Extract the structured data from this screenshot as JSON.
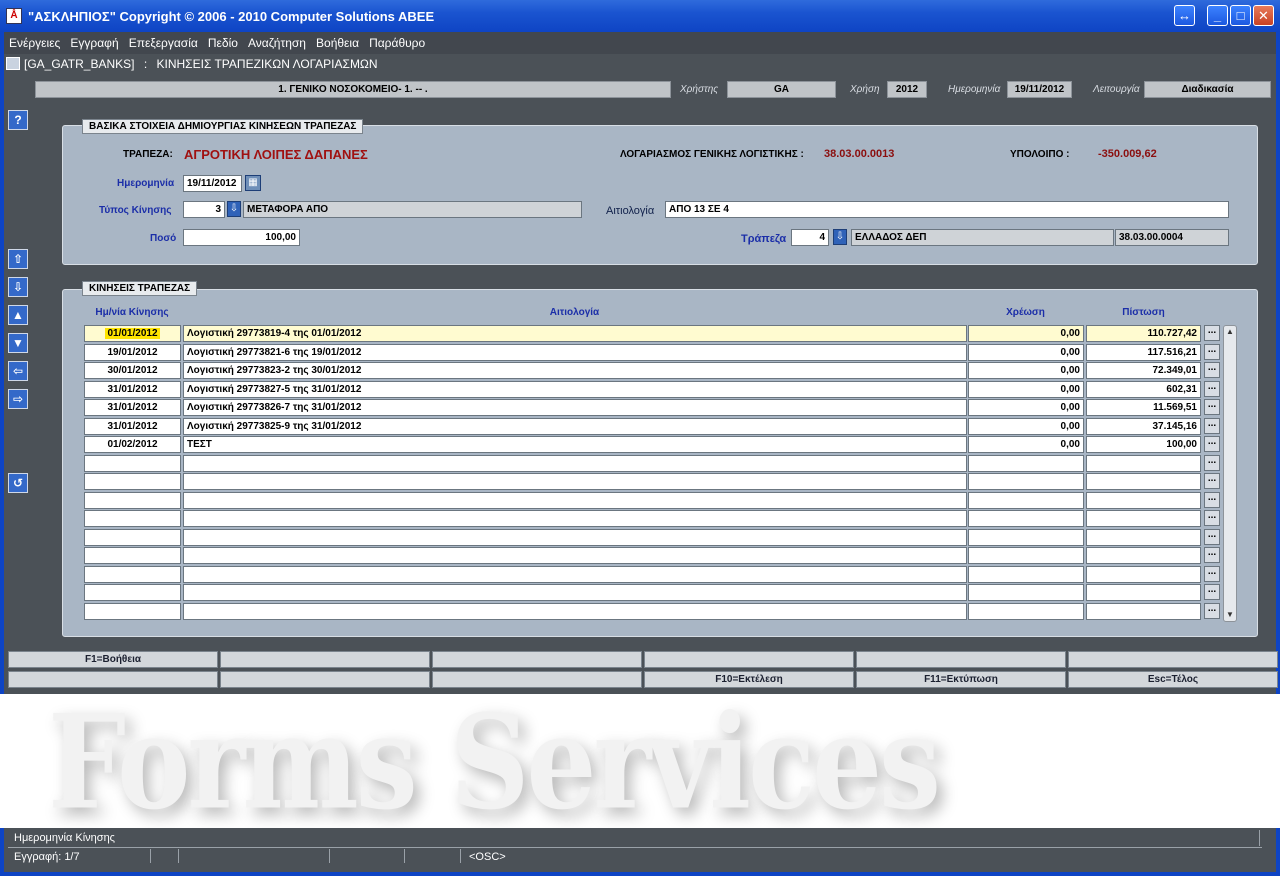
{
  "window": {
    "title": "\"ΑΣΚΛΗΠΙΟΣ\" Copyright © 2006 - 2010 Computer Solutions ABEE",
    "app_icon": "Å"
  },
  "menubar": [
    "Ενέργειες",
    "Εγγραφή",
    "Επεξεργασία",
    "Πεδίο",
    "Αναζήτηση",
    "Βοήθεια",
    "Παράθυρο"
  ],
  "form": {
    "code": "[GA_GATR_BANKS]",
    "separator": ":",
    "title": "ΚΙΝΗΣΕΙΣ ΤΡΑΠΕΖΙΚΩΝ ΛΟΓΑΡΙΑΣΜΩΝ"
  },
  "header": {
    "organization": "1. ΓΕΝΙΚΟ ΝΟΣΟΚΟΜΕΙΟ- 1. -- .",
    "user_label": "Χρήστης",
    "user_value": "GA",
    "year_label": "Χρήση",
    "year_value": "2012",
    "date_label": "Ημερομηνία",
    "date_value": "19/11/2012",
    "function_label": "Λειτουργία",
    "function_value": "Διαδικασία"
  },
  "basic_panel": {
    "title": "ΒΑΣΙΚΑ ΣΤΟΙΧΕΙΑ ΔΗΜΙΟΥΡΓΙΑΣ ΚΙΝΗΣΕΩΝ ΤΡΑΠΕΖΑΣ",
    "bank_label": "ΤΡΑΠΕΖΑ:",
    "bank_value": "ΑΓΡΟΤΙΚΗ ΛΟΙΠΕΣ ΔΑΠΑΝΕΣ",
    "gl_label": "ΛΟΓΑΡΙΑΣΜΟΣ ΓΕΝΙΚΗΣ ΛΟΓΙΣΤΙΚΗΣ :",
    "gl_value": "38.03.00.0013",
    "balance_label": "ΥΠΟΛΟΙΠΟ :",
    "balance_value": "-350.009,62",
    "date_label": "Ημερομηνία",
    "date_value": "19/11/2012",
    "type_label": "Τύπος Κίνησης",
    "type_code": "3",
    "type_desc": "ΜΕΤΑΦΟΡΑ ΑΠΟ",
    "reason_label": "Αιτιολογία",
    "reason_value": "ΑΠΟ 13 ΣΕ 4",
    "amount_label": "Ποσό",
    "amount_value": "100,00",
    "target_bank_label": "Τράπεζα",
    "target_bank_code": "4",
    "target_bank_desc": "ΕΛΛΑΔΟΣ ΔΕΠ",
    "target_bank_account": "38.03.00.0004"
  },
  "grid": {
    "title": "ΚΙΝΗΣΕΙΣ ΤΡΑΠΕΖΑΣ",
    "columns": {
      "date": "Ημ/νία Κίνησης",
      "reason": "Αιτιολογία",
      "debit": "Χρέωση",
      "credit": "Πίστωση"
    },
    "rows": [
      {
        "date": "01/01/2012",
        "reason": "Λογιστική 29773819-4 της 01/01/2012",
        "debit": "0,00",
        "credit": "110.727,42"
      },
      {
        "date": "19/01/2012",
        "reason": "Λογιστική 29773821-6 της 19/01/2012",
        "debit": "0,00",
        "credit": "117.516,21"
      },
      {
        "date": "30/01/2012",
        "reason": "Λογιστική 29773823-2 της 30/01/2012",
        "debit": "0,00",
        "credit": "72.349,01"
      },
      {
        "date": "31/01/2012",
        "reason": "Λογιστική 29773827-5 της 31/01/2012",
        "debit": "0,00",
        "credit": "602,31"
      },
      {
        "date": "31/01/2012",
        "reason": "Λογιστική 29773826-7 της 31/01/2012",
        "debit": "0,00",
        "credit": "11.569,51"
      },
      {
        "date": "31/01/2012",
        "reason": "Λογιστική 29773825-9 της 31/01/2012",
        "debit": "0,00",
        "credit": "37.145,16"
      },
      {
        "date": "01/02/2012",
        "reason": "ΤΕΣΤ",
        "debit": "0,00",
        "credit": "100,00"
      },
      {
        "date": "",
        "reason": "",
        "debit": "",
        "credit": ""
      },
      {
        "date": "",
        "reason": "",
        "debit": "",
        "credit": ""
      },
      {
        "date": "",
        "reason": "",
        "debit": "",
        "credit": ""
      },
      {
        "date": "",
        "reason": "",
        "debit": "",
        "credit": ""
      },
      {
        "date": "",
        "reason": "",
        "debit": "",
        "credit": ""
      },
      {
        "date": "",
        "reason": "",
        "debit": "",
        "credit": ""
      },
      {
        "date": "",
        "reason": "",
        "debit": "",
        "credit": ""
      },
      {
        "date": "",
        "reason": "",
        "debit": "",
        "credit": ""
      },
      {
        "date": "",
        "reason": "",
        "debit": "",
        "credit": ""
      }
    ],
    "row_button": "..."
  },
  "fkeys": {
    "row1": [
      "F1=Βοήθεια",
      "",
      "",
      "",
      "",
      ""
    ],
    "row2": [
      "",
      "",
      "",
      "F10=Εκτέλεση",
      "F11=Εκτύπωση",
      "Esc=Τέλος"
    ]
  },
  "watermark": "Forms Services",
  "status": {
    "hint": "Ημερομηνία Κίνησης",
    "record": "Εγγραφή: 1/7",
    "mode": "<OSC>"
  },
  "icons": {
    "help": "help-icon",
    "toolbar": [
      "first-record-icon",
      "next-record-icon",
      "scroll-up-icon",
      "scroll-down-icon",
      "previous-field-icon",
      "next-field-icon",
      "undo-icon"
    ]
  }
}
